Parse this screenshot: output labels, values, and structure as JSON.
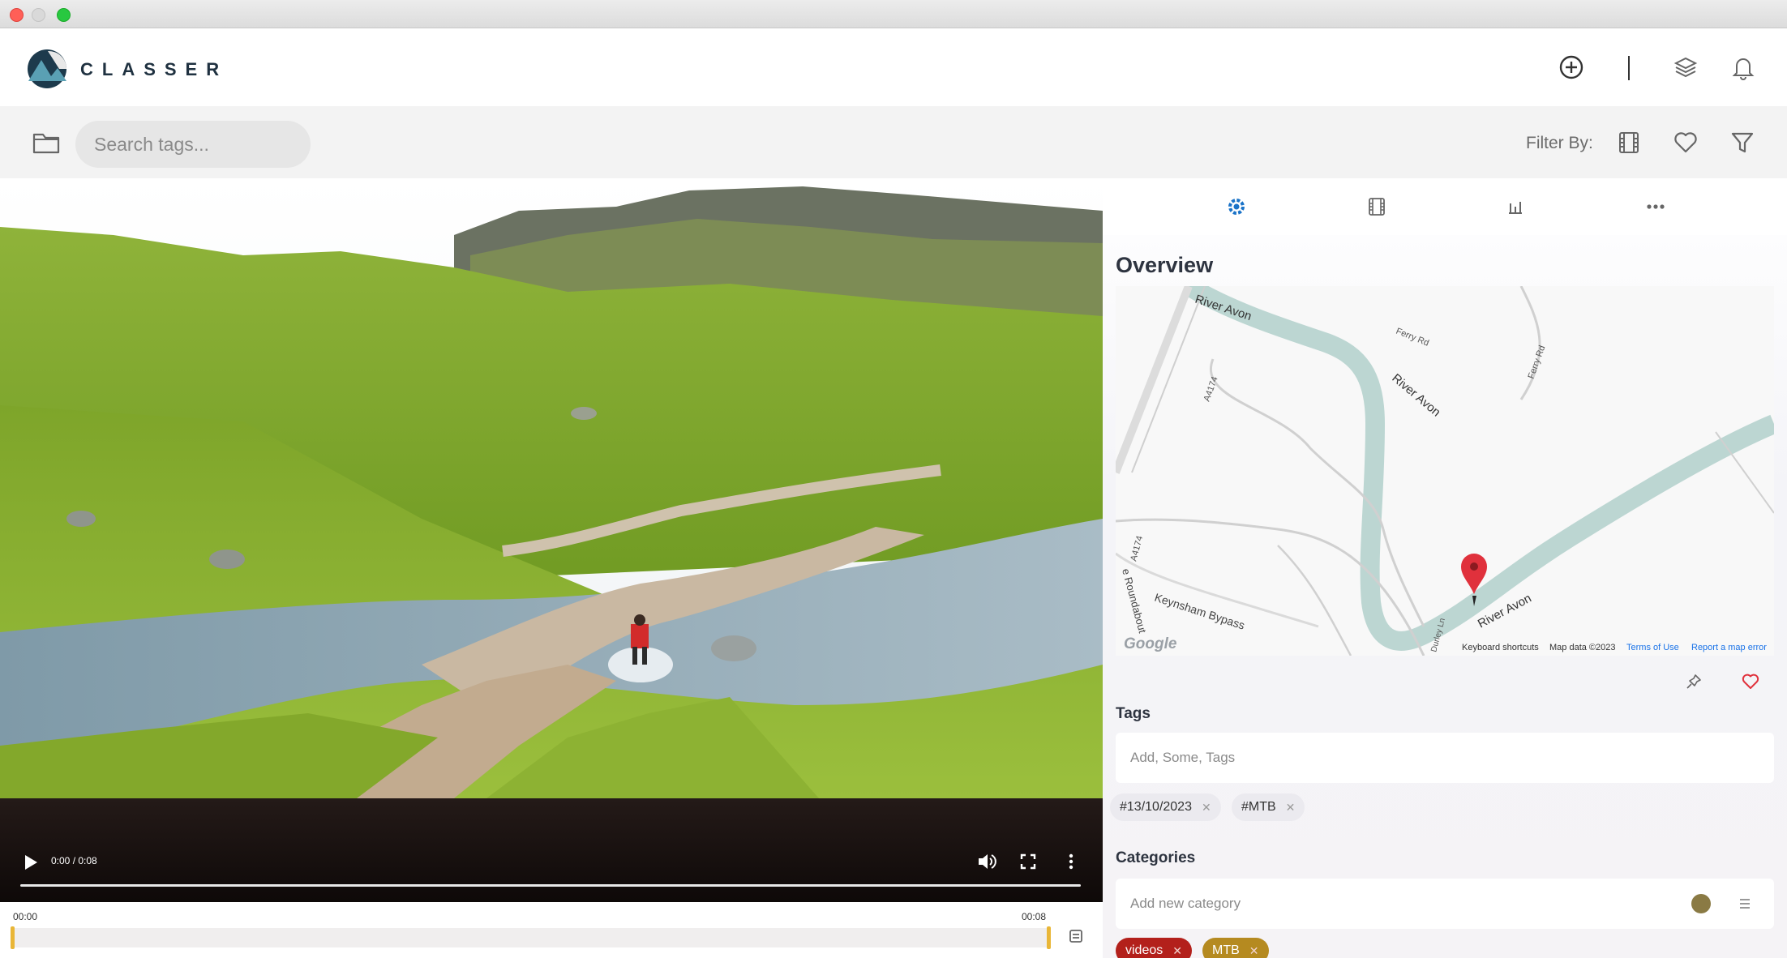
{
  "app": {
    "brand": "CLASSER"
  },
  "header": {
    "icons": [
      "add-circle-icon",
      "layers-icon",
      "bell-icon"
    ]
  },
  "toolbar": {
    "search_placeholder": "Search tags...",
    "filter_label": "Filter By:",
    "filter_icons": [
      "film-icon",
      "heart-icon",
      "filter-icon"
    ]
  },
  "video": {
    "time_display": "0:00 / 0:08",
    "timeline_start": "00:00",
    "timeline_end": "00:08",
    "progress": 0
  },
  "side_panel": {
    "tabs": [
      "settings-icon",
      "film-icon",
      "bar-chart-icon",
      "more-icon"
    ],
    "overview_title": "Overview",
    "map": {
      "labels": [
        "River Avon",
        "River Avon",
        "River Avon",
        "Ferry Rd",
        "Ferry Rd",
        "A4174",
        "A4174",
        "Keynsham Bypass",
        "Durley Ln",
        "e Roundabout"
      ],
      "logo": "Google",
      "footer": {
        "shortcuts": "Keyboard shortcuts",
        "data": "Map data ©2023",
        "terms": "Terms of Use",
        "report": "Report a map error"
      }
    },
    "tags": {
      "title": "Tags",
      "placeholder": "Add, Some, Tags",
      "chips": [
        "#13/10/2023",
        "#MTB"
      ]
    },
    "categories": {
      "title": "Categories",
      "placeholder": "Add new category",
      "chips": [
        {
          "label": "videos",
          "color": "#b3201b"
        },
        {
          "label": "MTB",
          "color": "#b58a20"
        }
      ],
      "selected_color": "#8a7a44"
    }
  },
  "colors": {
    "accent": "#1a73c8",
    "favorite": "#e0313c",
    "timeline_handle": "#e9b637"
  }
}
